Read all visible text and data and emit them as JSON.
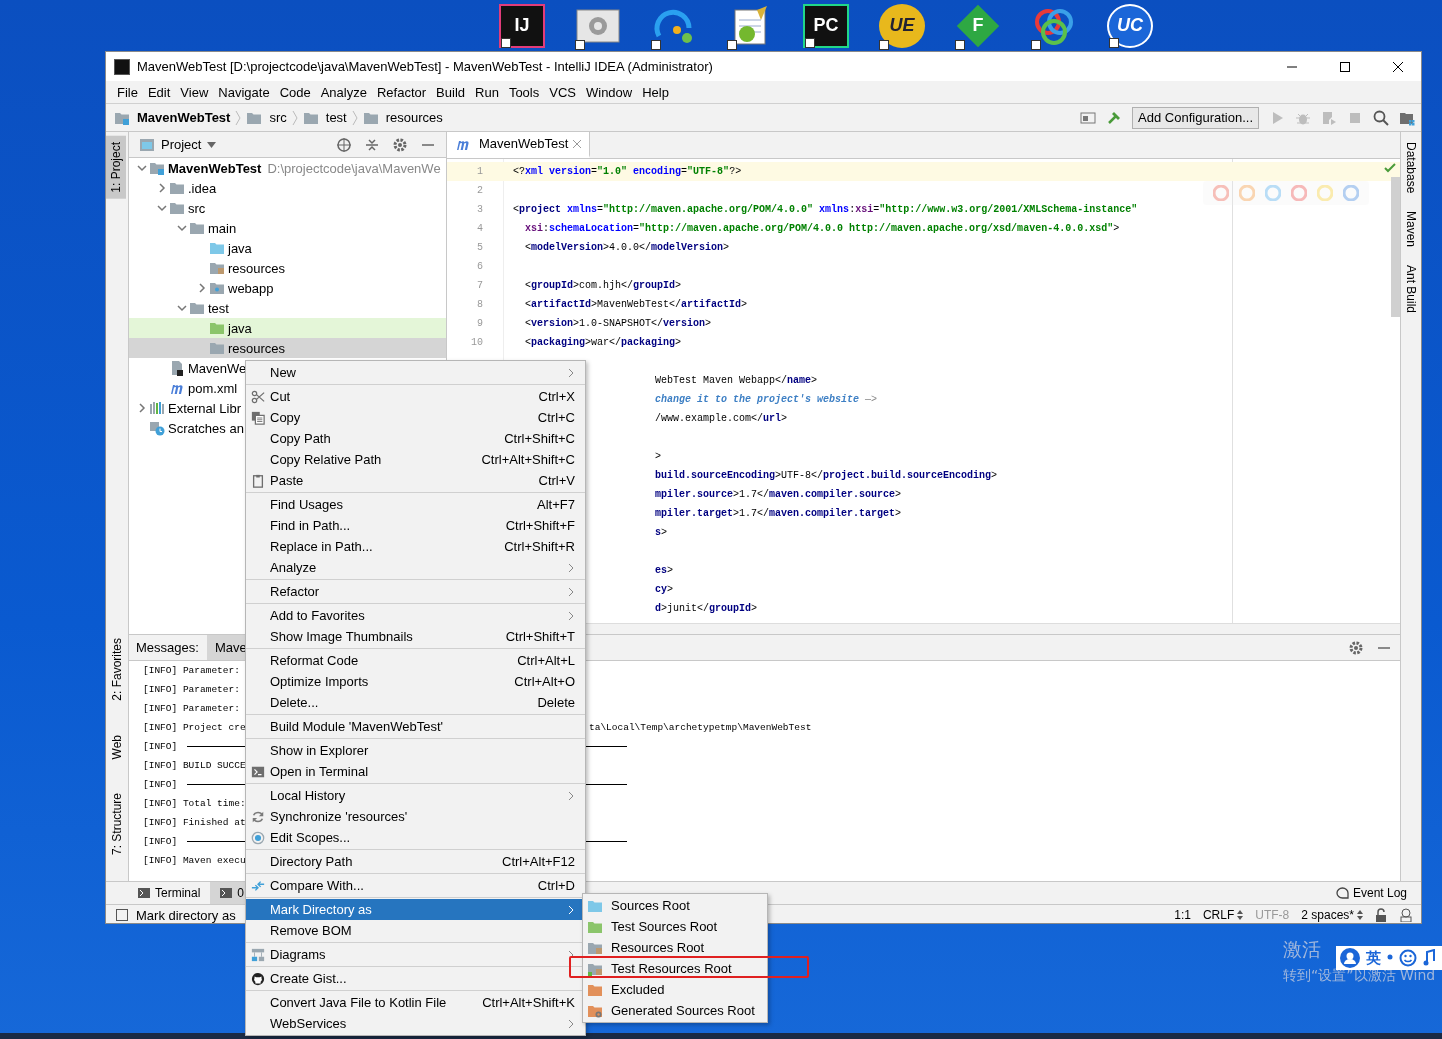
{
  "desktop": {
    "icons": [
      {
        "kind": "ij",
        "label": "IJ"
      },
      {
        "kind": "gear"
      },
      {
        "kind": "swirl"
      },
      {
        "kind": "notepad"
      },
      {
        "kind": "pc",
        "label": "PC"
      },
      {
        "kind": "ue",
        "label": "UE"
      },
      {
        "kind": "diamond",
        "label": "F"
      },
      {
        "kind": "petals"
      },
      {
        "kind": "uc",
        "label": "UC"
      }
    ],
    "activation": {
      "title": "激活",
      "subtitle": "转到“设置”以激活 Wind"
    },
    "ime_bar": {
      "mode": "英"
    }
  },
  "window": {
    "title": "MavenWebTest [D:\\projectcode\\java\\MavenWebTest] - MavenWebTest - IntelliJ IDEA (Administrator)"
  },
  "menu_bar": [
    "File",
    "Edit",
    "View",
    "Navigate",
    "Code",
    "Analyze",
    "Refactor",
    "Build",
    "Run",
    "Tools",
    "VCS",
    "Window",
    "Help"
  ],
  "breadcrumbs": [
    "MavenWebTest",
    "src",
    "test",
    "resources"
  ],
  "toolbar": {
    "run_config": "Add Configuration..."
  },
  "left_strip": {
    "top": [
      {
        "label": "1: Project",
        "selected": true
      }
    ],
    "bottom": [
      {
        "label": "2: Favorites",
        "selected": false
      },
      {
        "label": "Web",
        "selected": false
      },
      {
        "label": "7: Structure",
        "selected": false
      }
    ]
  },
  "right_strip": [
    "Database",
    "Maven",
    "Ant Build"
  ],
  "project_panel": {
    "title": "Project",
    "tree": [
      {
        "label": "MavenWebTest",
        "path": "D:\\projectcode\\java\\MavenWe",
        "kind": "module",
        "expanded": true,
        "selected": false,
        "children": [
          {
            "label": ".idea",
            "kind": "folder",
            "expanded": false,
            "selected": false
          },
          {
            "label": "src",
            "kind": "folder",
            "expanded": true,
            "selected": false,
            "children": [
              {
                "label": "main",
                "kind": "folder",
                "expanded": true,
                "selected": false,
                "children": [
                  {
                    "label": "java",
                    "kind": "source",
                    "selected": false
                  },
                  {
                    "label": "resources",
                    "kind": "resources",
                    "selected": false
                  },
                  {
                    "label": "webapp",
                    "kind": "web",
                    "expanded": false,
                    "selected": false
                  }
                ]
              },
              {
                "label": "test",
                "kind": "folder",
                "expanded": true,
                "selected": false,
                "children": [
                  {
                    "label": "java",
                    "kind": "test-source",
                    "selected": false
                  },
                  {
                    "label": "resources",
                    "kind": "folder",
                    "selected": true
                  }
                ]
              }
            ]
          },
          {
            "label": "MavenWe",
            "kind": "iml",
            "selected": false
          },
          {
            "label": "pom.xml",
            "kind": "maven",
            "selected": false
          }
        ]
      },
      {
        "label": "External Libr",
        "kind": "libraries",
        "expanded": false,
        "selected": false
      },
      {
        "label": "Scratches an",
        "kind": "scratches",
        "selected": false
      }
    ]
  },
  "editor": {
    "tab": "MavenWebTest",
    "lines": [
      {
        "kind": "code",
        "number": "1",
        "current": true,
        "code": [
          {
            "kind": "p",
            "text": "<?"
          },
          {
            "kind": "attr",
            "text": "xml"
          },
          {
            "kind": "attr",
            "text": " version"
          },
          {
            "kind": "p",
            "text": "="
          },
          {
            "kind": "val",
            "text": "\"1.0\""
          },
          {
            "kind": "attr",
            "text": " encoding"
          },
          {
            "kind": "p",
            "text": "="
          },
          {
            "kind": "val",
            "text": "\"UTF-8\""
          },
          {
            "kind": "p",
            "text": "?>"
          }
        ]
      },
      {
        "kind": "blank",
        "number": "2",
        "current": false
      },
      {
        "kind": "code",
        "number": "3",
        "current": false,
        "code": [
          {
            "kind": "p",
            "text": "<"
          },
          {
            "kind": "tag",
            "text": "project"
          },
          {
            "kind": "attr",
            "text": " xmlns"
          },
          {
            "kind": "p",
            "text": "="
          },
          {
            "kind": "val",
            "text": "\"http://maven.apache.org/POM/4.0.0\""
          },
          {
            "kind": "attr",
            "text": " xmlns"
          },
          {
            "kind": "p",
            "text": ":"
          },
          {
            "kind": "ns",
            "text": "xsi"
          },
          {
            "kind": "p",
            "text": "="
          },
          {
            "kind": "val",
            "text": "\"http://www.w3.org/2001/XMLSchema-instance\""
          }
        ]
      },
      {
        "kind": "code",
        "number": "4",
        "current": false,
        "code": [
          {
            "kind": "ns",
            "text": "  xsi"
          },
          {
            "kind": "p",
            "text": ":"
          },
          {
            "kind": "attr",
            "text": "schemaLocation"
          },
          {
            "kind": "p",
            "text": "="
          },
          {
            "kind": "val",
            "text": "\"http://maven.apache.org/POM/4.0.0 http://maven.apache.org/xsd/maven-4.0.0.xsd\""
          },
          {
            "kind": "p",
            "text": ">"
          }
        ]
      },
      {
        "kind": "code",
        "number": "5",
        "current": false,
        "code": [
          {
            "kind": "p",
            "text": "  <"
          },
          {
            "kind": "tag",
            "text": "modelVersion"
          },
          {
            "kind": "p",
            "text": ">4.0.0</"
          },
          {
            "kind": "tag",
            "text": "modelVersion"
          },
          {
            "kind": "p",
            "text": ">"
          }
        ]
      },
      {
        "kind": "blank",
        "number": "6",
        "current": false
      },
      {
        "kind": "code",
        "number": "7",
        "current": false,
        "code": [
          {
            "kind": "p",
            "text": "  <"
          },
          {
            "kind": "tag",
            "text": "groupId"
          },
          {
            "kind": "p",
            "text": ">com.hjh</"
          },
          {
            "kind": "tag",
            "text": "groupId"
          },
          {
            "kind": "p",
            "text": ">"
          }
        ]
      },
      {
        "kind": "code",
        "number": "8",
        "current": false,
        "code": [
          {
            "kind": "p",
            "text": "  <"
          },
          {
            "kind": "tag",
            "text": "artifactId"
          },
          {
            "kind": "p",
            "text": ">MavenWebTest</"
          },
          {
            "kind": "tag",
            "text": "artifactId"
          },
          {
            "kind": "p",
            "text": ">"
          }
        ]
      },
      {
        "kind": "code",
        "number": "9",
        "current": false,
        "code": [
          {
            "kind": "p",
            "text": "  <"
          },
          {
            "kind": "tag",
            "text": "version"
          },
          {
            "kind": "p",
            "text": ">1.0-SNAPSHOT</"
          },
          {
            "kind": "tag",
            "text": "version"
          },
          {
            "kind": "p",
            "text": ">"
          }
        ]
      },
      {
        "kind": "code",
        "number": "10",
        "current": false,
        "code": [
          {
            "kind": "p",
            "text": "  <"
          },
          {
            "kind": "tag",
            "text": "packaging"
          },
          {
            "kind": "p",
            "text": ">war</"
          },
          {
            "kind": "tag",
            "text": "packaging"
          },
          {
            "kind": "p",
            "text": ">"
          }
        ]
      },
      {
        "kind": "blank",
        "current": false
      },
      {
        "kind": "cut",
        "current": false,
        "code": [
          {
            "kind": "p",
            "text": "WebTest Maven Webapp</"
          },
          {
            "kind": "tag",
            "text": "name"
          },
          {
            "kind": "p",
            "text": ">"
          }
        ]
      },
      {
        "kind": "cut",
        "current": false,
        "code": [
          {
            "kind": "comment",
            "text": "change it to the project's website"
          },
          {
            "kind": "dim",
            "text": " —>"
          }
        ]
      },
      {
        "kind": "cut",
        "current": false,
        "code": [
          {
            "kind": "p",
            "text": "/www.example.com</"
          },
          {
            "kind": "tag",
            "text": "url"
          },
          {
            "kind": "p",
            "text": ">"
          }
        ]
      },
      {
        "kind": "blank",
        "current": false
      },
      {
        "kind": "cut",
        "current": false,
        "code": [
          {
            "kind": "p",
            "text": ">"
          }
        ]
      },
      {
        "kind": "cut",
        "current": false,
        "code": [
          {
            "kind": "tag",
            "text": "build.sourceEncoding"
          },
          {
            "kind": "p",
            "text": ">UTF-8</"
          },
          {
            "kind": "tag",
            "text": "project.build.sourceEncoding"
          },
          {
            "kind": "p",
            "text": ">"
          }
        ]
      },
      {
        "kind": "cut",
        "current": false,
        "code": [
          {
            "kind": "tag",
            "text": "mpiler.source"
          },
          {
            "kind": "p",
            "text": ">1.7</"
          },
          {
            "kind": "tag",
            "text": "maven.compiler.source"
          },
          {
            "kind": "p",
            "text": ">"
          }
        ]
      },
      {
        "kind": "cut",
        "current": false,
        "code": [
          {
            "kind": "tag",
            "text": "mpiler.target"
          },
          {
            "kind": "p",
            "text": ">1.7</"
          },
          {
            "kind": "tag",
            "text": "maven.compiler.target"
          },
          {
            "kind": "p",
            "text": ">"
          }
        ]
      },
      {
        "kind": "cut",
        "current": false,
        "code": [
          {
            "kind": "tag",
            "text": "s"
          },
          {
            "kind": "p",
            "text": ">"
          }
        ]
      },
      {
        "kind": "blank",
        "current": false
      },
      {
        "kind": "cut",
        "current": false,
        "code": [
          {
            "kind": "tag",
            "text": "es"
          },
          {
            "kind": "p",
            "text": ">"
          }
        ]
      },
      {
        "kind": "cut",
        "current": false,
        "code": [
          {
            "kind": "tag",
            "text": "cy"
          },
          {
            "kind": "p",
            "text": ">"
          }
        ]
      },
      {
        "kind": "cut",
        "current": false,
        "code": [
          {
            "kind": "tag",
            "text": "d"
          },
          {
            "kind": "p",
            "text": ">junit</"
          },
          {
            "kind": "tag",
            "text": "groupId"
          },
          {
            "kind": "p",
            "text": ">"
          }
        ]
      }
    ]
  },
  "messages": {
    "title": "Messages:",
    "tab": "Mave",
    "lines": [
      {
        "text": "[INFO] Parameter:",
        "rule": false
      },
      {
        "text": "[INFO] Parameter:",
        "rule": false
      },
      {
        "text": "[INFO] Parameter:",
        "rule": false
      },
      {
        "text": "[INFO] Project cre",
        "rest": "ta\\Local\\Temp\\archetypetmp\\MavenWebTest",
        "rule": false
      },
      {
        "text": "[INFO]",
        "rule": true
      },
      {
        "text": "[INFO] BUILD SUCCE",
        "rule": false
      },
      {
        "text": "[INFO]",
        "rule": true
      },
      {
        "text": "[INFO] Total time:",
        "rule": false
      },
      {
        "text": "[INFO] Finished at",
        "rule": false
      },
      {
        "text": "[INFO]",
        "rule": true
      },
      {
        "text": "[INFO] Maven execu",
        "rule": false
      }
    ]
  },
  "tool_tabs": [
    {
      "label": "Terminal",
      "selected": false
    },
    {
      "label": "0",
      "selected": true
    }
  ],
  "event_log": "Event Log",
  "status_bar": {
    "message": "Mark directory as",
    "items": [
      {
        "text": "1:1",
        "dimmed": false,
        "dropdown": false
      },
      {
        "text": "CRLF",
        "dimmed": false,
        "dropdown": true
      },
      {
        "text": "UTF-8",
        "dimmed": true,
        "dropdown": false
      },
      {
        "text": "2 spaces*",
        "dimmed": false,
        "dropdown": true
      }
    ]
  },
  "context_menu": [
    {
      "kind": "plain",
      "label": "New",
      "submenu": true,
      "selected": false
    },
    {
      "kind": "separator"
    },
    {
      "kind": "cut",
      "label": "Cut",
      "shortcut": "Ctrl+X",
      "selected": false
    },
    {
      "kind": "copy",
      "label": "Copy",
      "shortcut": "Ctrl+C",
      "selected": false
    },
    {
      "kind": "plain",
      "label": "Copy Path",
      "shortcut": "Ctrl+Shift+C",
      "selected": false
    },
    {
      "kind": "plain",
      "label": "Copy Relative Path",
      "shortcut": "Ctrl+Alt+Shift+C",
      "selected": false
    },
    {
      "kind": "paste",
      "label": "Paste",
      "shortcut": "Ctrl+V",
      "selected": false
    },
    {
      "kind": "separator"
    },
    {
      "kind": "plain",
      "label": "Find Usages",
      "shortcut": "Alt+F7",
      "selected": false
    },
    {
      "kind": "plain",
      "label": "Find in Path...",
      "shortcut": "Ctrl+Shift+F",
      "selected": false
    },
    {
      "kind": "plain",
      "label": "Replace in Path...",
      "shortcut": "Ctrl+Shift+R",
      "selected": false
    },
    {
      "kind": "plain",
      "label": "Analyze",
      "submenu": true,
      "selected": false
    },
    {
      "kind": "separator"
    },
    {
      "kind": "plain",
      "label": "Refactor",
      "submenu": true,
      "selected": false
    },
    {
      "kind": "separator"
    },
    {
      "kind": "plain",
      "label": "Add to Favorites",
      "submenu": true,
      "selected": false
    },
    {
      "kind": "plain",
      "label": "Show Image Thumbnails",
      "shortcut": "Ctrl+Shift+T",
      "selected": false
    },
    {
      "kind": "separator"
    },
    {
      "kind": "plain",
      "label": "Reformat Code",
      "shortcut": "Ctrl+Alt+L",
      "selected": false
    },
    {
      "kind": "plain",
      "label": "Optimize Imports",
      "shortcut": "Ctrl+Alt+O",
      "selected": false
    },
    {
      "kind": "plain",
      "label": "Delete...",
      "shortcut": "Delete",
      "selected": false
    },
    {
      "kind": "separator"
    },
    {
      "kind": "plain",
      "label": "Build Module 'MavenWebTest'",
      "selected": false
    },
    {
      "kind": "separator"
    },
    {
      "kind": "plain",
      "label": "Show in Explorer",
      "selected": false
    },
    {
      "kind": "terminal",
      "label": "Open in Terminal",
      "selected": false
    },
    {
      "kind": "separator"
    },
    {
      "kind": "plain",
      "label": "Local History",
      "submenu": true,
      "selected": false
    },
    {
      "kind": "sync",
      "label": "Synchronize 'resources'",
      "selected": false
    },
    {
      "kind": "scopes",
      "label": "Edit Scopes...",
      "selected": false
    },
    {
      "kind": "separator"
    },
    {
      "kind": "plain",
      "label": "Directory Path",
      "shortcut": "Ctrl+Alt+F12",
      "selected": false
    },
    {
      "kind": "separator"
    },
    {
      "kind": "compare",
      "label": "Compare With...",
      "shortcut": "Ctrl+D",
      "selected": false
    },
    {
      "kind": "separator"
    },
    {
      "kind": "plain",
      "label": "Mark Directory as",
      "submenu": true,
      "selected": true
    },
    {
      "kind": "plain",
      "label": "Remove BOM",
      "selected": false
    },
    {
      "kind": "separator"
    },
    {
      "kind": "diagram",
      "label": "Diagrams",
      "submenu": true,
      "selected": false
    },
    {
      "kind": "separator"
    },
    {
      "kind": "github",
      "label": "Create Gist...",
      "selected": false
    },
    {
      "kind": "separator"
    },
    {
      "kind": "plain",
      "label": "Convert Java File to Kotlin File",
      "shortcut": "Ctrl+Alt+Shift+K",
      "selected": false
    },
    {
      "kind": "plain",
      "label": "WebServices",
      "submenu": true,
      "selected": false
    }
  ],
  "submenu": [
    {
      "label": "Sources Root",
      "kind": "source",
      "selected": false,
      "annotated": false
    },
    {
      "label": "Test Sources Root",
      "kind": "test-source",
      "selected": false,
      "annotated": false
    },
    {
      "label": "Resources Root",
      "kind": "resources",
      "selected": false,
      "annotated": false
    },
    {
      "label": "Test Resources Root",
      "kind": "test-resources",
      "selected": false,
      "annotated": true
    },
    {
      "label": "Excluded",
      "kind": "excluded",
      "selected": false,
      "annotated": false
    },
    {
      "label": "Generated Sources Root",
      "kind": "generated",
      "selected": false,
      "annotated": false
    }
  ]
}
